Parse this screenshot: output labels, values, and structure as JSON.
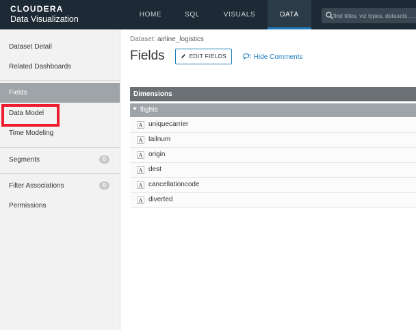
{
  "header": {
    "brand": "CLOUDERA",
    "product": "Data Visualization",
    "nav": [
      {
        "label": "HOME"
      },
      {
        "label": "SQL"
      },
      {
        "label": "VISUALS"
      },
      {
        "label": "DATA",
        "active": true
      }
    ],
    "search": {
      "placeholder": "find titles, viz types, datasets, ..."
    }
  },
  "sidebar": {
    "items": [
      {
        "label": "Dataset Detail"
      },
      {
        "label": "Related Dashboards"
      },
      {
        "label": "Fields",
        "active": true
      },
      {
        "label": "Data Model",
        "highlighted": true
      },
      {
        "label": "Time Modeling"
      },
      {
        "label": "Segments",
        "count": "0"
      },
      {
        "label": "Filter Associations",
        "count": "0"
      },
      {
        "label": "Permissions"
      }
    ]
  },
  "main": {
    "dataset_label": "Dataset:",
    "dataset_name": "airline_logistics",
    "title": "Fields",
    "edit_button": "EDIT FIELDS",
    "hide_comments": "Hide Comments",
    "dimensions_header": "Dimensions",
    "group": "flights",
    "fields": [
      {
        "type": "A",
        "name": "uniquecarrier"
      },
      {
        "type": "A",
        "name": "tailnum"
      },
      {
        "type": "A",
        "name": "origin"
      },
      {
        "type": "A",
        "name": "dest"
      },
      {
        "type": "A",
        "name": "cancellationcode"
      },
      {
        "type": "A",
        "name": "diverted"
      }
    ]
  },
  "colors": {
    "topbar": "#1d2a35",
    "accent": "#1e7dbf",
    "highlight_box": "#ee1c2e",
    "active_sidebar": "#9ea4a8"
  }
}
